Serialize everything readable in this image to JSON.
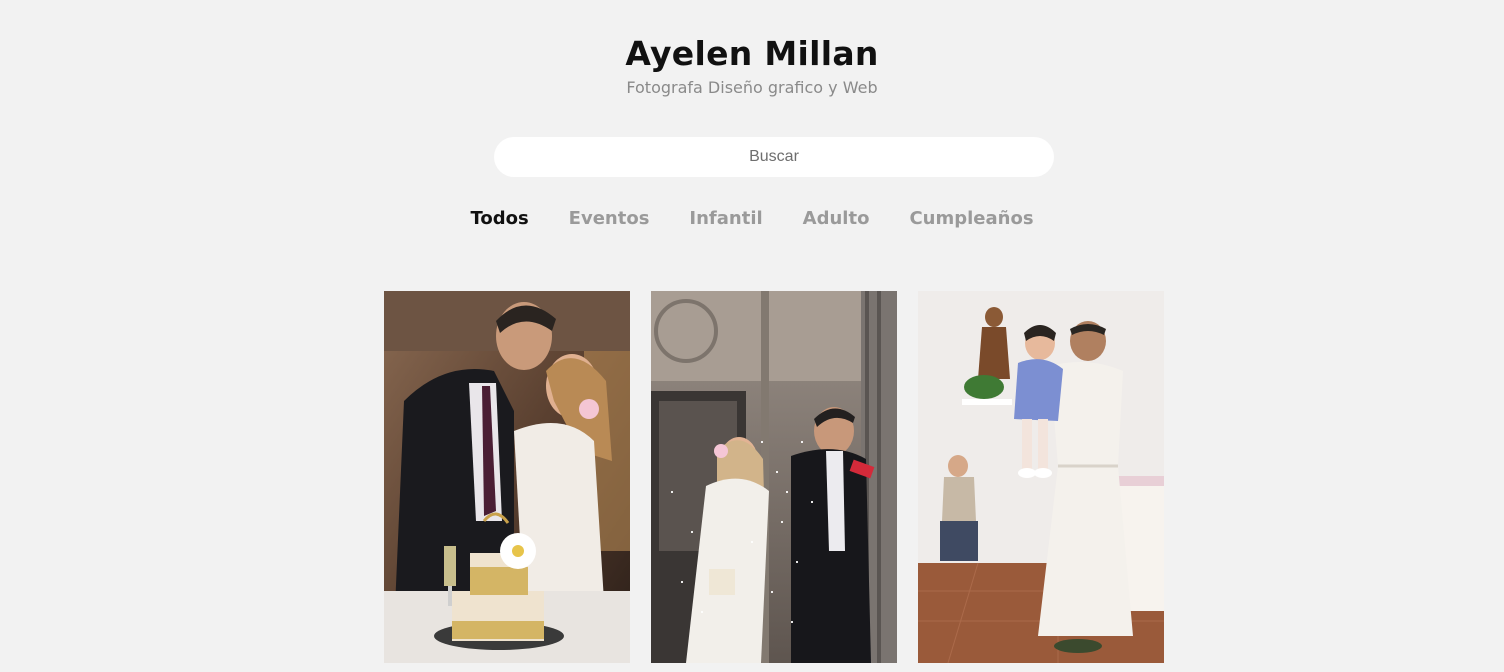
{
  "header": {
    "title": "Ayelen Millan",
    "subtitle": "Fotografa Diseño grafico y Web"
  },
  "search": {
    "placeholder": "Buscar",
    "value": ""
  },
  "filters": [
    {
      "label": "Todos",
      "active": true
    },
    {
      "label": "Eventos",
      "active": false
    },
    {
      "label": "Infantil",
      "active": false
    },
    {
      "label": "Adulto",
      "active": false
    },
    {
      "label": "Cumpleaños",
      "active": false
    }
  ],
  "gallery": {
    "photos": [
      {
        "subject": "couple kissing beside wedding cake"
      },
      {
        "subject": "newlyweds leaving building under rice shower"
      },
      {
        "subject": "man in white robe lifting toddler in church"
      }
    ]
  },
  "colors": {
    "background": "#f2f2f2",
    "title": "#111111",
    "subtitle": "#8a8a8a",
    "tab_active": "#111111",
    "tab_inactive": "#9a9a9a",
    "search_bg": "#ffffff"
  }
}
